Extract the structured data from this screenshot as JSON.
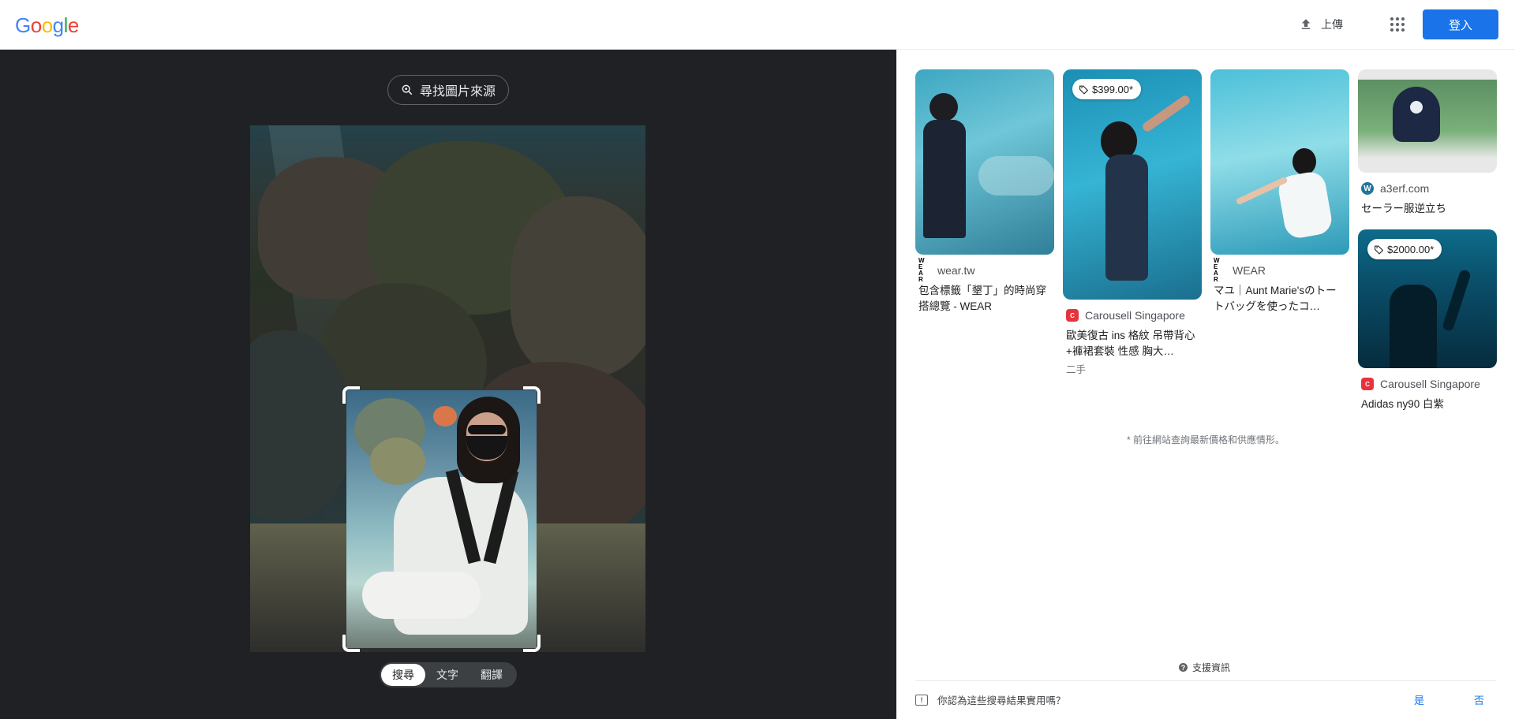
{
  "header": {
    "logo": [
      "G",
      "o",
      "o",
      "g",
      "l",
      "e"
    ],
    "logo_colors": [
      "#4285f4",
      "#ea4335",
      "#fbbc05",
      "#4285f4",
      "#34a853",
      "#ea4335"
    ],
    "upload_label": "上傳",
    "upload_icon": "upload-icon",
    "apps_icon": "apps-grid-icon",
    "signin_label": "登入"
  },
  "lens": {
    "find_source_label": "尋找圖片來源",
    "find_source_icon": "lens-search-icon",
    "tabs": [
      {
        "label": "搜尋",
        "active": true
      },
      {
        "label": "文字",
        "active": false
      },
      {
        "label": "翻譯",
        "active": false
      }
    ]
  },
  "results": {
    "columns": [
      [
        {
          "source_icon": "wear-logo-icon",
          "source_icon_text": [
            "W E",
            "A R"
          ],
          "source": "wear.tw",
          "title": "包含標籤「墾丁」的時尚穿搭總覽 - WEAR",
          "price": null,
          "sub": null
        }
      ],
      [
        {
          "source_icon": "carousell-logo-icon",
          "source": "Carousell Singapore",
          "title": "歐美復古 ins 格紋 吊帶背心+褲裙套裝 性感 胸大…",
          "price": "$399.00*",
          "sub": "二手"
        }
      ],
      [
        {
          "source_icon": "wear-logo-icon",
          "source_icon_text": [
            "W E",
            "A R"
          ],
          "source": "WEAR",
          "title": "マユ｜Aunt Marie'sのトートバッグを使ったコ…",
          "price": null,
          "sub": null
        }
      ],
      [
        {
          "source_icon": "wordpress-logo-icon",
          "source_icon_text": "W",
          "source": "a3erf.com",
          "title": "セーラー服逆立ち",
          "price": null,
          "sub": null
        },
        {
          "source_icon": "carousell-logo-icon",
          "source": "Carousell Singapore",
          "title": "Adidas ny90 白紫",
          "price": "$2000.00*",
          "sub": null
        }
      ]
    ],
    "notice": "* 前往網站查詢最新價格和供應情形。",
    "help_label": "支援資訊",
    "feedback_question": "你認為這些搜尋結果實用嗎？",
    "feedback_yes": "是",
    "feedback_no": "否"
  },
  "colors": {
    "accent": "#1a73e8",
    "dark_panel": "#202124",
    "carousell": "#e8323c"
  }
}
